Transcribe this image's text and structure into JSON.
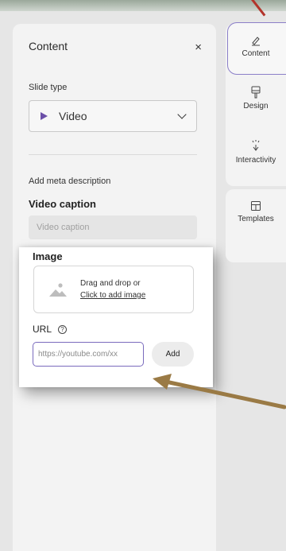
{
  "panel": {
    "title": "Content",
    "close_glyph": "×",
    "slide_type_label": "Slide type",
    "slide_type_value": "Video",
    "meta_link": "Add meta description",
    "caption_heading": "Video caption",
    "caption_placeholder": "Video caption"
  },
  "image_card": {
    "title": "Image",
    "drop_text": "Drag and drop or",
    "drop_link": "Click to add image",
    "url_label": "URL",
    "help_glyph": "?",
    "url_placeholder": "https://youtube.com/xx",
    "add_label": "Add"
  },
  "rail": {
    "items": [
      {
        "label": "Content",
        "icon": "pen-icon",
        "active": true
      },
      {
        "label": "Design",
        "icon": "brush-icon",
        "active": false
      },
      {
        "label": "Interactivity",
        "icon": "sparkle-hand-icon",
        "active": false
      },
      {
        "label": "Templates",
        "icon": "grid-icon",
        "active": false
      }
    ]
  },
  "colors": {
    "accent": "#7a6bbd",
    "play_icon": "#6b4fa8",
    "annotation_arrow": "#9a7a45",
    "annotation_line": "#b3342b"
  }
}
